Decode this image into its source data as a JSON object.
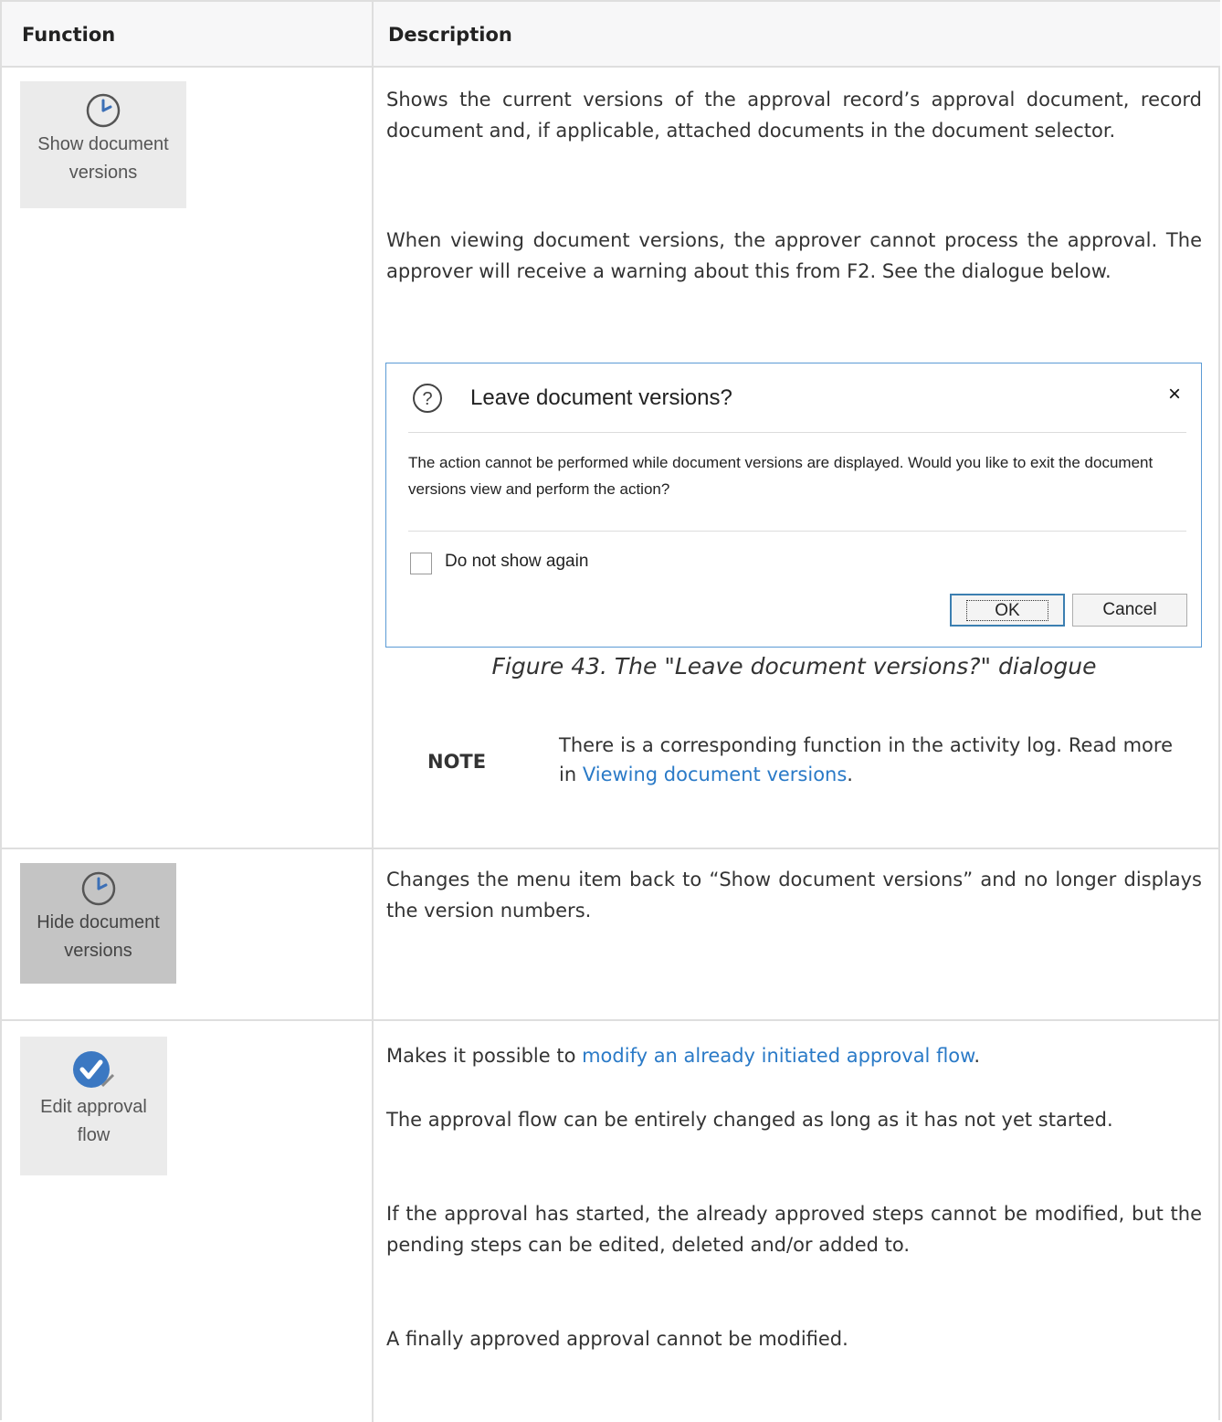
{
  "header": {
    "function": "Function",
    "description": "Description"
  },
  "rows": [
    {
      "button": {
        "line1": "Show document",
        "line2": "versions",
        "icon": "clock-icon"
      },
      "p1": "Shows the current versions of the approval record’s approval document, record document and, if applicable, attached documents in the document selector.",
      "p2": "When viewing document versions, the approver cannot process the approval. The approver will receive a warning about this from F2. See the dialogue below.",
      "dialog": {
        "title": "Leave document versions?",
        "close": "×",
        "message": "The action cannot be performed while document versions are displayed. Would you like to exit the document versions view and perform the action?",
        "checkbox_label": "Do not show again",
        "ok": "OK",
        "cancel": "Cancel"
      },
      "caption": "Figure 43. The \"Leave document versions?\" dialogue",
      "note": {
        "label": "NOTE",
        "text_before": "There is a corresponding function in the activity log. Read more in ",
        "link": "Viewing document versions",
        "text_after": "."
      }
    },
    {
      "button": {
        "line1": "Hide document",
        "line2": "versions",
        "icon": "clock-icon"
      },
      "p1": "Changes the menu item back to “Show document versions” and no longer displays the version numbers."
    },
    {
      "button": {
        "line1": "Edit approval",
        "line2": "flow",
        "icon": "checkmark-edit-icon"
      },
      "p1_before": "Makes it possible to ",
      "p1_link": "modify an already initiated approval flow",
      "p1_after": ".",
      "p2": "The approval flow can be entirely changed as long as it has not yet started.",
      "p3": "If the approval has started, the already approved steps cannot be modified, but the pending steps can be edited, deleted and/or added to.",
      "p4": "A finally approved approval cannot be modified."
    }
  ],
  "colors": {
    "link": "#2a7ac7",
    "border": "#dedede",
    "dialog_border": "#5b9bd5"
  }
}
